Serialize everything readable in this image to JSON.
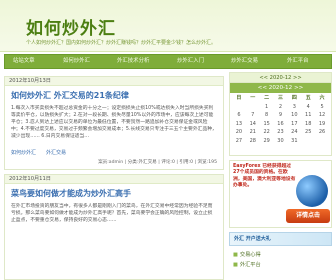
{
  "header": {
    "title": "如何炒外汇",
    "tagline": "个人如何炒外汇？国内如何炒外汇？炒外汇赚钱吗？炒外汇平要金少钱？怎么炒外汇。"
  },
  "nav": {
    "items": [
      "站站文章",
      "如何炒外汇",
      "外汇技术分析",
      "炒外汇入门",
      "炒外汇交易",
      "外汇平台"
    ]
  },
  "posts": [
    {
      "date": "2012年10月13日",
      "title": "如何炒外汇 外汇交易的21条纪律",
      "body": "1.每次入市买卖损失不超过总资金的十分之一；设定损损失止损10%或达损失入时当所损失买利等卖价平仓，以防损失扩大；2.在对一段长期、损失尽量10%以外的市场中，应该每次上述可能平仓；3.忍人到达上述应以交易的单位为最低位置，不要贸然一路追加补仓交易保证金或风险中；4.不要过度交易，交易过于频繁会增加交易成本；5.长线交易只专注于三五个主要外汇品种，减少出现…… 6.日内交易保证适当…",
      "tags": [
        "如何炒外汇",
        "外汇交易"
      ],
      "meta": "案员:admin | 分类:外汇交易 | 评论:0 | 引用:0 | 浏览:195"
    },
    {
      "date": "2012年10月11日",
      "title": "菜鸟要如何做才能成为炒外汇高手",
      "body": "在外汇市场投资的朋友当中，有很多人都是刚刚入门的菜鸟，在外汇交易中经常因为经验不足而亏损。那么菜鸟要如何做才能成为炒外汇高手呢？首先，菜鸟要学会正确的风险控制，设立止损止盈点，不要重仓交易，保持良好的交易心态……"
    }
  ],
  "calendar": {
    "head": "<< 2020-12 >>",
    "nav": "<< 2020-12 >>",
    "weekdays": [
      "日",
      "一",
      "二",
      "三",
      "四",
      "五",
      "六"
    ],
    "days": [
      "",
      "",
      "1",
      "2",
      "3",
      "4",
      "5",
      "6",
      "7",
      "8",
      "9",
      "10",
      "11",
      "12",
      "13",
      "14",
      "15",
      "16",
      "17",
      "18",
      "19",
      "20",
      "21",
      "22",
      "23",
      "24",
      "25",
      "26",
      "27",
      "28",
      "29",
      "30",
      "31",
      "",
      ""
    ]
  },
  "ad": {
    "text": "EasyForex 已经获得超过27个成员国的资格。在欧洲，美国，澳大利亚等地设有办事处。",
    "button": "详情点击",
    "banner": "外汇 开户送大礼"
  },
  "sidebar_links": [
    "交易心得",
    "外汇平台"
  ]
}
